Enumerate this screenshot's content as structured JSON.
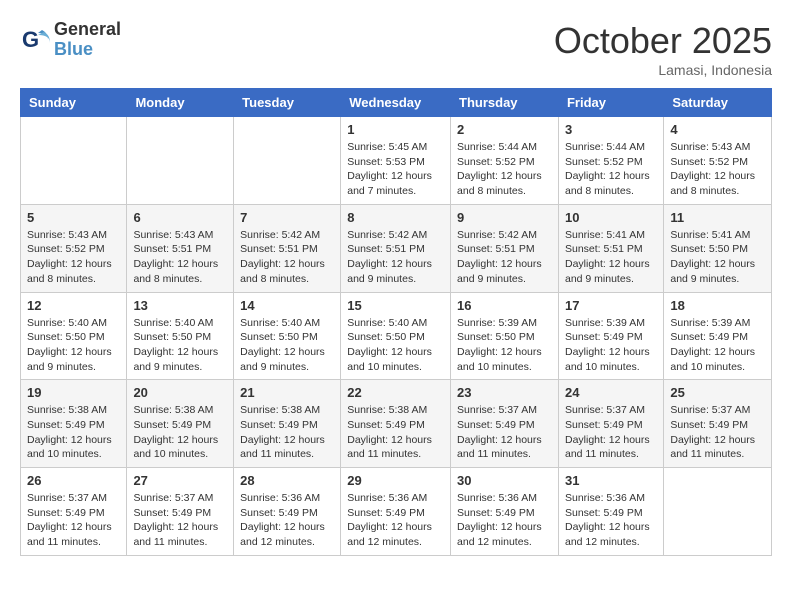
{
  "header": {
    "logo_line1": "General",
    "logo_line2": "Blue",
    "month": "October 2025",
    "location": "Lamasi, Indonesia"
  },
  "weekdays": [
    "Sunday",
    "Monday",
    "Tuesday",
    "Wednesday",
    "Thursday",
    "Friday",
    "Saturday"
  ],
  "weeks": [
    [
      {
        "day": "",
        "info": ""
      },
      {
        "day": "",
        "info": ""
      },
      {
        "day": "",
        "info": ""
      },
      {
        "day": "1",
        "info": "Sunrise: 5:45 AM\nSunset: 5:53 PM\nDaylight: 12 hours\nand 7 minutes."
      },
      {
        "day": "2",
        "info": "Sunrise: 5:44 AM\nSunset: 5:52 PM\nDaylight: 12 hours\nand 8 minutes."
      },
      {
        "day": "3",
        "info": "Sunrise: 5:44 AM\nSunset: 5:52 PM\nDaylight: 12 hours\nand 8 minutes."
      },
      {
        "day": "4",
        "info": "Sunrise: 5:43 AM\nSunset: 5:52 PM\nDaylight: 12 hours\nand 8 minutes."
      }
    ],
    [
      {
        "day": "5",
        "info": "Sunrise: 5:43 AM\nSunset: 5:52 PM\nDaylight: 12 hours\nand 8 minutes."
      },
      {
        "day": "6",
        "info": "Sunrise: 5:43 AM\nSunset: 5:51 PM\nDaylight: 12 hours\nand 8 minutes."
      },
      {
        "day": "7",
        "info": "Sunrise: 5:42 AM\nSunset: 5:51 PM\nDaylight: 12 hours\nand 8 minutes."
      },
      {
        "day": "8",
        "info": "Sunrise: 5:42 AM\nSunset: 5:51 PM\nDaylight: 12 hours\nand 9 minutes."
      },
      {
        "day": "9",
        "info": "Sunrise: 5:42 AM\nSunset: 5:51 PM\nDaylight: 12 hours\nand 9 minutes."
      },
      {
        "day": "10",
        "info": "Sunrise: 5:41 AM\nSunset: 5:51 PM\nDaylight: 12 hours\nand 9 minutes."
      },
      {
        "day": "11",
        "info": "Sunrise: 5:41 AM\nSunset: 5:50 PM\nDaylight: 12 hours\nand 9 minutes."
      }
    ],
    [
      {
        "day": "12",
        "info": "Sunrise: 5:40 AM\nSunset: 5:50 PM\nDaylight: 12 hours\nand 9 minutes."
      },
      {
        "day": "13",
        "info": "Sunrise: 5:40 AM\nSunset: 5:50 PM\nDaylight: 12 hours\nand 9 minutes."
      },
      {
        "day": "14",
        "info": "Sunrise: 5:40 AM\nSunset: 5:50 PM\nDaylight: 12 hours\nand 9 minutes."
      },
      {
        "day": "15",
        "info": "Sunrise: 5:40 AM\nSunset: 5:50 PM\nDaylight: 12 hours\nand 10 minutes."
      },
      {
        "day": "16",
        "info": "Sunrise: 5:39 AM\nSunset: 5:50 PM\nDaylight: 12 hours\nand 10 minutes."
      },
      {
        "day": "17",
        "info": "Sunrise: 5:39 AM\nSunset: 5:49 PM\nDaylight: 12 hours\nand 10 minutes."
      },
      {
        "day": "18",
        "info": "Sunrise: 5:39 AM\nSunset: 5:49 PM\nDaylight: 12 hours\nand 10 minutes."
      }
    ],
    [
      {
        "day": "19",
        "info": "Sunrise: 5:38 AM\nSunset: 5:49 PM\nDaylight: 12 hours\nand 10 minutes."
      },
      {
        "day": "20",
        "info": "Sunrise: 5:38 AM\nSunset: 5:49 PM\nDaylight: 12 hours\nand 10 minutes."
      },
      {
        "day": "21",
        "info": "Sunrise: 5:38 AM\nSunset: 5:49 PM\nDaylight: 12 hours\nand 11 minutes."
      },
      {
        "day": "22",
        "info": "Sunrise: 5:38 AM\nSunset: 5:49 PM\nDaylight: 12 hours\nand 11 minutes."
      },
      {
        "day": "23",
        "info": "Sunrise: 5:37 AM\nSunset: 5:49 PM\nDaylight: 12 hours\nand 11 minutes."
      },
      {
        "day": "24",
        "info": "Sunrise: 5:37 AM\nSunset: 5:49 PM\nDaylight: 12 hours\nand 11 minutes."
      },
      {
        "day": "25",
        "info": "Sunrise: 5:37 AM\nSunset: 5:49 PM\nDaylight: 12 hours\nand 11 minutes."
      }
    ],
    [
      {
        "day": "26",
        "info": "Sunrise: 5:37 AM\nSunset: 5:49 PM\nDaylight: 12 hours\nand 11 minutes."
      },
      {
        "day": "27",
        "info": "Sunrise: 5:37 AM\nSunset: 5:49 PM\nDaylight: 12 hours\nand 11 minutes."
      },
      {
        "day": "28",
        "info": "Sunrise: 5:36 AM\nSunset: 5:49 PM\nDaylight: 12 hours\nand 12 minutes."
      },
      {
        "day": "29",
        "info": "Sunrise: 5:36 AM\nSunset: 5:49 PM\nDaylight: 12 hours\nand 12 minutes."
      },
      {
        "day": "30",
        "info": "Sunrise: 5:36 AM\nSunset: 5:49 PM\nDaylight: 12 hours\nand 12 minutes."
      },
      {
        "day": "31",
        "info": "Sunrise: 5:36 AM\nSunset: 5:49 PM\nDaylight: 12 hours\nand 12 minutes."
      },
      {
        "day": "",
        "info": ""
      }
    ]
  ]
}
